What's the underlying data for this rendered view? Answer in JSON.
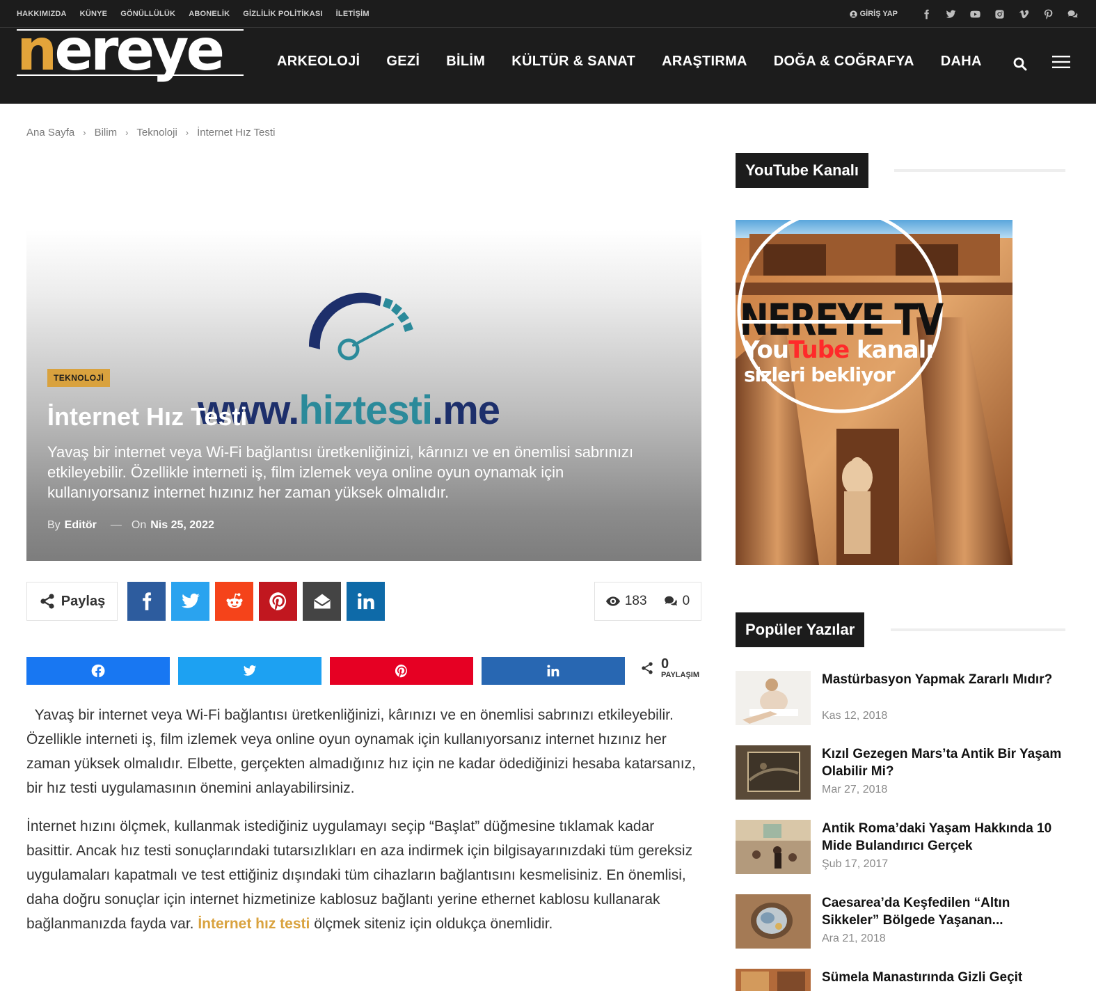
{
  "topbar": {
    "links": [
      "HAKKIMIZDA",
      "KÜNYE",
      "GÖNÜLLÜLÜK",
      "ABONELİK",
      "GİZLİLİK POLİTİKASI",
      "İLETİŞİM"
    ],
    "login_label": "GİRİŞ YAP",
    "social_icons": [
      "facebook-icon",
      "twitter-icon",
      "youtube-icon",
      "instagram-icon",
      "vimeo-icon",
      "pinterest-icon",
      "comments-icon"
    ]
  },
  "header": {
    "logo_text": "nereye",
    "nav": [
      "ARKEOLOJİ",
      "GEZİ",
      "BİLİM",
      "KÜLTÜR & SANAT",
      "ARAŞTIRMA",
      "DOĞA & COĞRAFYA",
      "DAHA"
    ]
  },
  "breadcrumb": [
    "Ana Sayfa",
    "Bilim",
    "Teknoloji",
    "İnternet Hız Testi"
  ],
  "hero": {
    "image_url_www": "www.",
    "image_url_brand": "hiztesti",
    "image_url_tld": ".me",
    "category": "TEKNOLOJİ",
    "title": "İnternet Hız Testi",
    "subtitle": "Yavaş bir internet veya Wi-Fi bağlantısı üretkenliğinizi, kârınızı ve en önemlisi sabrınızı etkileyebilir. Özellikle interneti iş, film izlemek veya online oyun oynamak için kullanıyorsanız internet hızınız her zaman yüksek olmalıdır.",
    "by_label": "By",
    "author": "Editör",
    "dash": "—",
    "on_label": "On",
    "date": "Nis 25, 2022"
  },
  "share": {
    "label": "Paylaş",
    "views": "183",
    "comments": "0",
    "share_count": "0",
    "share_count_label": "PAYLAŞIM",
    "colors": {
      "facebook": "#2d5c9e",
      "twitter": "#2aa3ef",
      "reddit": "#f5431a",
      "pinterest": "#c1171f",
      "email": "#444444",
      "linkedin": "#0e6aa8"
    },
    "colors2": {
      "facebook": "#1877f2",
      "twitter": "#1da1f2",
      "pinterest": "#e60023",
      "linkedin": "#2867b2"
    }
  },
  "article": {
    "p1": "  Yavaş bir internet veya Wi-Fi bağlantısı üretkenliğinizi, kârınızı ve en önemlisi sabrınızı etkileyebilir. Özellikle interneti iş, film izlemek veya online oyun oynamak için kullanıyorsanız internet hızınız her zaman yüksek olmalıdır. Elbette, gerçekten almadığınız hız için ne kadar ödediğinizi hesaba katarsanız, bir hız testi uygulamasının önemini anlayabilirsiniz.",
    "p2_before": "İnternet hızını ölçmek, kullanmak istediğiniz uygulamayı seçip “Başlat” düğmesine tıklamak kadar basittir. Ancak hız testi sonuçlarındaki tutarsızlıkları en aza indirmek için bilgisayarınızdaki tüm gereksiz uygulamaları kapatmalı ve test ettiğiniz dışındaki tüm cihazların bağlantısını kesmelisiniz. En önemlisi, daha doğru sonuçlar için internet hizmetinize kablosuz bağlantı yerine ethernet kablosu kullanarak bağlanmanızda fayda var. ",
    "p2_link": "İnternet hız testi",
    "p2_after": " ölçmek siteniz için oldukça önemlidir."
  },
  "sidebar": {
    "youtube_heading": "YouTube Kanalı",
    "yt_banner": {
      "line1": "NEREYE TV",
      "you": "You",
      "tube": "Tube",
      "line2_rest": " kanalı",
      "line3": "sizleri bekliyor"
    },
    "popular_heading": "Popüler Yazılar",
    "popular": [
      {
        "title": "Mastürbasyon Yapmak Zararlı Mıdır?",
        "date": "Kas 12, 2018"
      },
      {
        "title": "Kızıl Gezegen Mars’ta Antik Bir Yaşam Olabilir Mi?",
        "date": "Mar 27, 2018"
      },
      {
        "title": "Antik Roma’daki Yaşam Hakkında 10 Mide Bulandırıcı Gerçek",
        "date": "Şub 17, 2017"
      },
      {
        "title": "Caesarea’da Keşfedilen “Altın Sikkeler” Bölgede Yaşanan...",
        "date": "Ara 21, 2018"
      },
      {
        "title": "Sümela Manastırında Gizli Geçit",
        "date": ""
      }
    ]
  }
}
